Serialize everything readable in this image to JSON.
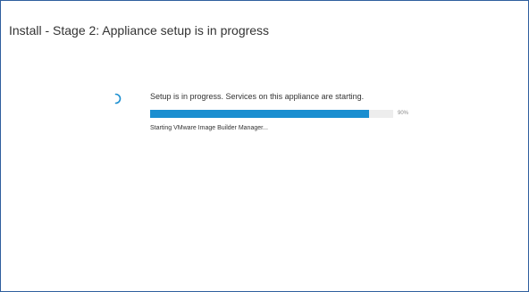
{
  "header": {
    "title": "Install - Stage 2: Appliance setup is in progress"
  },
  "progress": {
    "status_text": "Setup is in progress. Services on this appliance are starting.",
    "percent_value": 90,
    "percent_label": "90%",
    "current_task": "Starting VMware Image Builder Manager...",
    "spinner_icon": "loading-spinner-icon",
    "accent_color": "#1a8ed0",
    "track_color": "#ededed"
  },
  "window": {
    "border_color": "#2f5f9e"
  }
}
